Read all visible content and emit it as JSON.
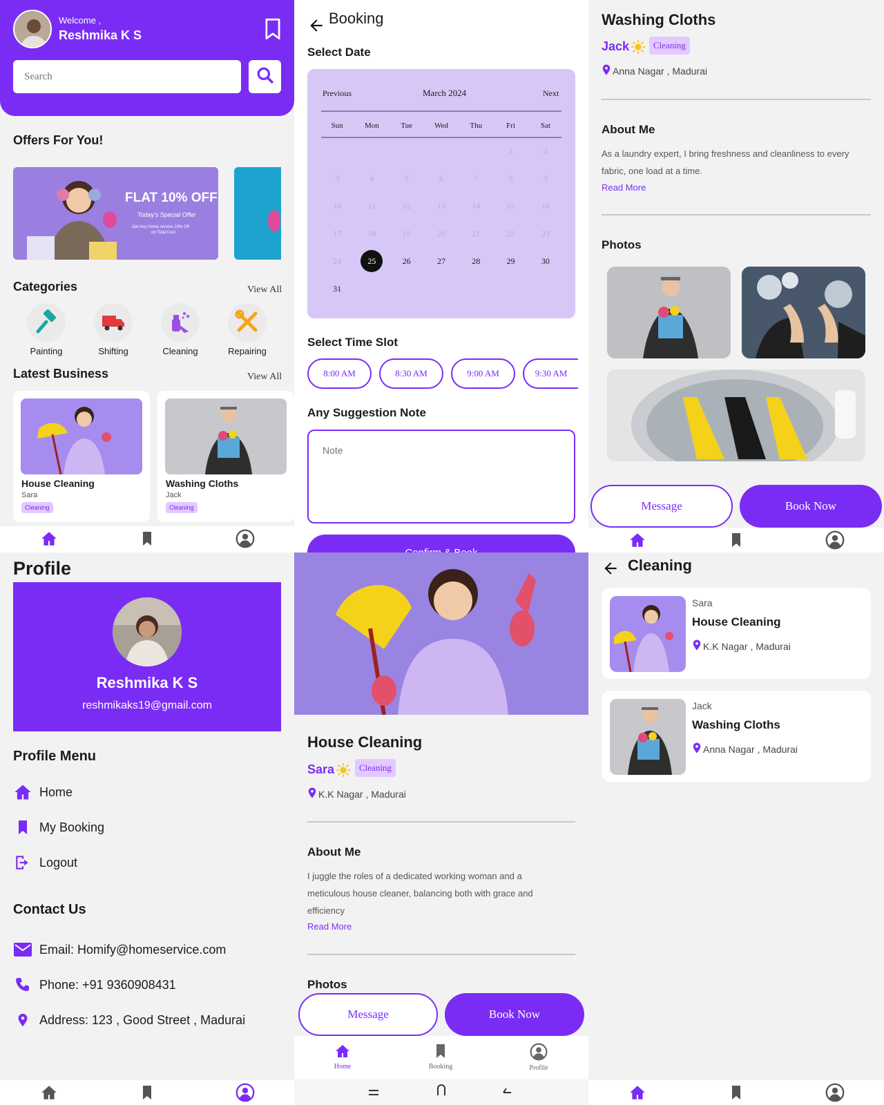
{
  "colors": {
    "accent": "#7a2cf5",
    "accent_light": "#d7c7f7",
    "tag_bg": "#e2c9ff",
    "background": "#f2f2f2"
  },
  "home": {
    "welcome": "Welcome ,",
    "user_name": "Reshmika K S",
    "search_placeholder": "Search",
    "offers_title": "Offers For You!",
    "offer": {
      "headline": "FLAT 10% OFF",
      "sub": "Today's Special Offer",
      "fine1": "Get Any Home service 10% Off",
      "fine2": "on Total Cost"
    },
    "categories_title": "Categories",
    "view_all": "View All",
    "categories": [
      {
        "label": "Painting",
        "icon": "paint-roller-icon"
      },
      {
        "label": "Shifting",
        "icon": "truck-icon"
      },
      {
        "label": "Cleaning",
        "icon": "cleaning-spray-icon"
      },
      {
        "label": "Repairing",
        "icon": "tools-icon"
      }
    ],
    "latest_title": "Latest Business",
    "businesses": [
      {
        "title": "House Cleaning",
        "provider": "Sara",
        "tag": "Cleaning"
      },
      {
        "title": "Washing Cloths",
        "provider": "Jack",
        "tag": "Cleaning"
      }
    ]
  },
  "booking": {
    "title": "Booking",
    "select_date": "Select Date",
    "cal_prev": "Previous",
    "cal_month": "March  2024",
    "cal_next": "Next",
    "weekdays": [
      "Sun",
      "Mon",
      "Tue",
      "Wed",
      "Thu",
      "Fri",
      "Sat"
    ],
    "selected_day": "25",
    "select_time": "Select Time Slot",
    "slots": [
      "8:00 AM",
      "8:30 AM",
      "9:00 AM",
      "9:30 AM"
    ],
    "note_title": "Any Suggestion Note",
    "note_placeholder": "Note",
    "confirm": "Confirm & Book"
  },
  "wash_detail": {
    "title": "Washing Cloths",
    "provider": "Jack",
    "tag": "Cleaning",
    "location": "Anna Nagar , Madurai",
    "about_title": "About Me",
    "about_line1": "As a laundry expert, I bring freshness and cleanliness to every",
    "about_line2": "fabric, one load at a time.",
    "read_more": "Read More",
    "photos_title": "Photos",
    "message": "Message",
    "book_now": "Book Now"
  },
  "profile": {
    "title": "Profile",
    "name": "Reshmika K S",
    "email": "reshmikaks19@gmail.com",
    "menu_title": "Profile Menu",
    "menu": [
      {
        "label": "Home",
        "icon": "home-icon"
      },
      {
        "label": "My Booking",
        "icon": "bookmark-icon"
      },
      {
        "label": "Logout",
        "icon": "logout-icon"
      }
    ],
    "contact_title": "Contact Us",
    "contact": [
      {
        "label": "Email: Homify@homeservice.com",
        "icon": "mail-icon"
      },
      {
        "label": "Phone: +91 9360908431",
        "icon": "phone-icon"
      },
      {
        "label": "Address: 123 , Good Street , Madurai",
        "icon": "location-pin-icon"
      }
    ]
  },
  "house_detail": {
    "title": "House Cleaning",
    "provider": "Sara",
    "tag": "Cleaning",
    "location": "K.K Nagar , Madurai",
    "about_title": "About Me",
    "about_line1": "I juggle the roles of a dedicated working woman and a",
    "about_line2": "meticulous house cleaner, balancing both with grace and",
    "about_line3": "efficiency",
    "read_more": "Read More",
    "photos_title": "Photos",
    "message": "Message",
    "book_now": "Book Now",
    "nav": [
      "Home",
      "Booking",
      "Profile"
    ]
  },
  "cleaning_list": {
    "title": "Cleaning",
    "items": [
      {
        "provider": "Sara",
        "title": "House Cleaning",
        "location": "K.K Nagar , Madurai"
      },
      {
        "provider": "Jack",
        "title": "Washing Cloths",
        "location": "Anna Nagar , Madurai"
      }
    ]
  }
}
